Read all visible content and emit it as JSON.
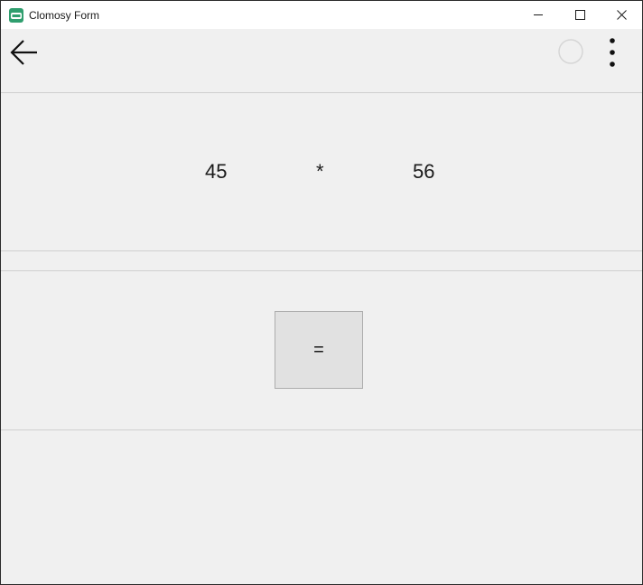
{
  "window": {
    "title": "Clomosy Form",
    "icon": "clomosy-app-icon",
    "controls": [
      "minimize-icon",
      "maximize-icon",
      "close-icon"
    ]
  },
  "appbar": {
    "back_icon": "arrow-left-icon",
    "refresh_icon": "circle-outline-icon",
    "menu_icon": "more-vertical-icon"
  },
  "expression": {
    "operand_a": "45",
    "operator": "*",
    "operand_b": "56"
  },
  "equals_button": {
    "label": "="
  }
}
